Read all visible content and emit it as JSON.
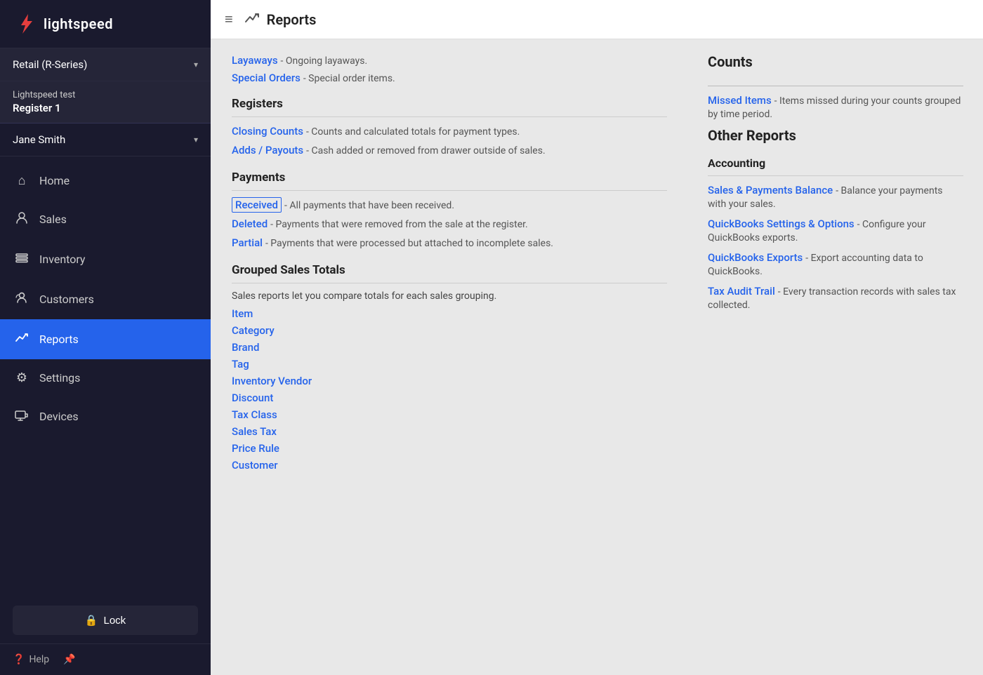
{
  "sidebar": {
    "logo_text": "lightspeed",
    "retail_label": "Retail (R-Series)",
    "register_top": "Lightspeed test",
    "register_name": "Register 1",
    "user_name": "Jane Smith",
    "nav_items": [
      {
        "id": "home",
        "label": "Home",
        "icon": "🏠"
      },
      {
        "id": "sales",
        "label": "Sales",
        "icon": "👤"
      },
      {
        "id": "inventory",
        "label": "Inventory",
        "icon": "🗂"
      },
      {
        "id": "customers",
        "label": "Customers",
        "icon": "👤"
      },
      {
        "id": "reports",
        "label": "Reports",
        "icon": "📈",
        "active": true
      },
      {
        "id": "settings",
        "label": "Settings",
        "icon": "⚙"
      },
      {
        "id": "devices",
        "label": "Devices",
        "icon": "🖥"
      }
    ],
    "lock_label": "Lock",
    "help_label": "Help"
  },
  "topbar": {
    "title": "Reports",
    "hamburger_label": "menu"
  },
  "content": {
    "scrolled_items": [
      {
        "id": "layaways",
        "link_text": "Layaways",
        "desc": "Ongoing layaways."
      },
      {
        "id": "special-orders",
        "link_text": "Special Orders",
        "desc": "Special order items."
      }
    ],
    "sections": [
      {
        "id": "registers",
        "header": "Registers",
        "items": [
          {
            "id": "closing-counts",
            "link_text": "Closing Counts",
            "desc": "Counts and calculated totals for payment types.",
            "highlighted": false
          },
          {
            "id": "adds-payouts",
            "link_text": "Adds / Payouts",
            "desc": "Cash added or removed from drawer outside of sales.",
            "highlighted": false
          }
        ]
      },
      {
        "id": "payments",
        "header": "Payments",
        "items": [
          {
            "id": "received",
            "link_text": "Received",
            "desc": "All payments that have been received.",
            "highlighted": true
          },
          {
            "id": "deleted",
            "link_text": "Deleted",
            "desc": "Payments that were removed from the sale at the register.",
            "highlighted": false
          },
          {
            "id": "partial",
            "link_text": "Partial",
            "desc": "Payments that were processed but attached to incomplete sales.",
            "highlighted": false
          }
        ]
      },
      {
        "id": "grouped-sales-totals",
        "header": "Grouped Sales Totals",
        "description": "Sales reports let you compare totals for each sales grouping.",
        "simple_links": [
          {
            "id": "item",
            "label": "Item"
          },
          {
            "id": "category",
            "label": "Category"
          },
          {
            "id": "brand",
            "label": "Brand"
          },
          {
            "id": "tag",
            "label": "Tag"
          },
          {
            "id": "inventory-vendor",
            "label": "Inventory Vendor"
          },
          {
            "id": "discount",
            "label": "Discount"
          },
          {
            "id": "tax-class",
            "label": "Tax Class"
          },
          {
            "id": "sales-tax",
            "label": "Sales Tax"
          },
          {
            "id": "price-rule",
            "label": "Price Rule"
          },
          {
            "id": "customer",
            "label": "Customer"
          }
        ]
      }
    ]
  },
  "right_panel": {
    "counts_header": "Counts",
    "counts_items": [
      {
        "id": "missed-items",
        "link_text": "Missed Items",
        "desc": "Items missed during your counts grouped by time period."
      }
    ],
    "other_reports_header": "Other Reports",
    "accounting_header": "Accounting",
    "accounting_items": [
      {
        "id": "sales-payments-balance",
        "link_text": "Sales & Payments Balance",
        "desc": "Balance your payments with your sales."
      },
      {
        "id": "quickbooks-settings",
        "link_text": "QuickBooks Settings & Options",
        "desc": "Configure your QuickBooks exports."
      },
      {
        "id": "quickbooks-exports",
        "link_text": "QuickBooks Exports",
        "desc": "Export accounting data to QuickBooks."
      },
      {
        "id": "tax-audit-trail",
        "link_text": "Tax Audit Trail",
        "desc": "Every transaction records with sales tax collected."
      }
    ]
  }
}
